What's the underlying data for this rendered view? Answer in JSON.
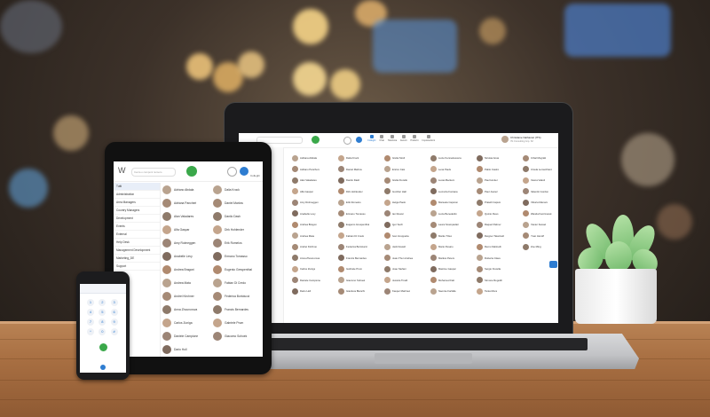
{
  "tablet": {
    "logo": "W",
    "search_placeholder": "Cerca o componi numero",
    "nav_items": [
      "Tutti",
      "Administration",
      "Area Managers",
      "Country Managers",
      "Development",
      "Events",
      "External",
      "Help Desk",
      "Management Development",
      "Marketing_DE",
      "Support"
    ],
    "contacts_left": [
      "Adriano Abdala",
      "Adriana Pancheri",
      "Alan Valadares",
      "Alfa Gaspar",
      "Amy Rolmeggen",
      "Anabelle Levy",
      "Andrea Bragoni",
      "Andrea Mata",
      "Andrei Kirchner",
      "Anna Zhounorova",
      "Carlos Zuniga",
      "Daniele Campione",
      "Dario Holl"
    ],
    "contacts_right": [
      "Dalia Krock",
      "Daniel Marlow",
      "Danilo Dash",
      "Dirk Hohlender",
      "Erik Romelos",
      "Ermano Tomasso",
      "Eugenio Grespenthal",
      "Fabian Di Credo",
      "Federica Bortolucci",
      "Francis Bernardes",
      "Gabriele Prum",
      "Giacomo Sohoek"
    ],
    "colleagues_label": "Colleghi",
    "recent_label": "Ultime"
  },
  "laptop": {
    "user_name": "Christiane Nathaniel (ITS)",
    "user_sub": "ITs Consulting Grp. Srl",
    "tabs": [
      "Colleghi",
      "Chat",
      "Telefonia",
      "Eventi",
      "Preferiti",
      "Impostazioni"
    ],
    "columns": [
      [
        "Adriana Abdala",
        "Adriano Panchero",
        "Alan Valadares",
        "Alfa Gaspar",
        "Amy Rolmeggen",
        "Anabelle Levy",
        "Andrea Bragoni",
        "Andrea Mata",
        "Andrei Kirchner",
        "Anna Zhounorova",
        "Carlos Zuniga",
        "Daniele Campione",
        "Dario Holl"
      ],
      [
        "Dalia Krock",
        "Daniel Marlow",
        "Danilo Dash",
        "Dirk Hohlender",
        "Erik Romelos",
        "Ermano Tomasso",
        "Eugenio Grespenthal",
        "Fabian Di Credo",
        "Federica Bortolucci",
        "Francis Bernardes",
        "Gabriele Prum",
        "Giacomo Sohoek",
        "Gianluca Bianchi"
      ],
      [
        "Giulia Stroll",
        "Enrico Cais",
        "Giulia Fiorello",
        "Gunther Hall",
        "Helga Paolo",
        "Ian Rowan",
        "Igor Sech",
        "Ivan Gruppetta",
        "Jack Dowell",
        "Jean-Then Andrea",
        "Joao Stefani",
        "Jessica Tinelli",
        "Kasper Martinez"
      ],
      [
        "Lucie Kennedesoura",
        "Lena Pauls",
        "Lucas Beckers",
        "Lucrezia Fontana",
        "Manuela Caputon",
        "Lucia Benedettini",
        "Laura Scampadari",
        "Marko Trites",
        "Mario Pesaro",
        "Markus Peters",
        "Maxime Gaspar",
        "Mohamed Fatt",
        "Naomie Farfalle"
      ],
      [
        "Nicolas Anas",
        "Pablo Castro",
        "Paul Hunter",
        "Paul Juarez",
        "Pratelli Caputo",
        "Quinto Reus",
        "Raquel Palmer",
        "Reigner Tatarinelli",
        "Remo Marinelli",
        "Roberta Clave",
        "Sergio Fiorella",
        "Simone Regoldi",
        "Tania Mona"
      ],
      [
        "Urbal Mugniki",
        "Ursula Lemarchant",
        "Vesna Vakuli",
        "Valentin Gordon",
        "Vittoria Marvelo",
        "Wanda Kaczmarek",
        "Xavier Kessel",
        "Yvan Aleroff",
        "Zoe Ming"
      ]
    ]
  },
  "phone": {
    "keys": [
      "1",
      "2",
      "3",
      "4",
      "5",
      "6",
      "7",
      "8",
      "9",
      "*",
      "0",
      "#"
    ]
  },
  "colors": {
    "accent": "#2e7dd1",
    "call_green": "#3aa84a",
    "initials_avatar": "#9bbf3a"
  }
}
